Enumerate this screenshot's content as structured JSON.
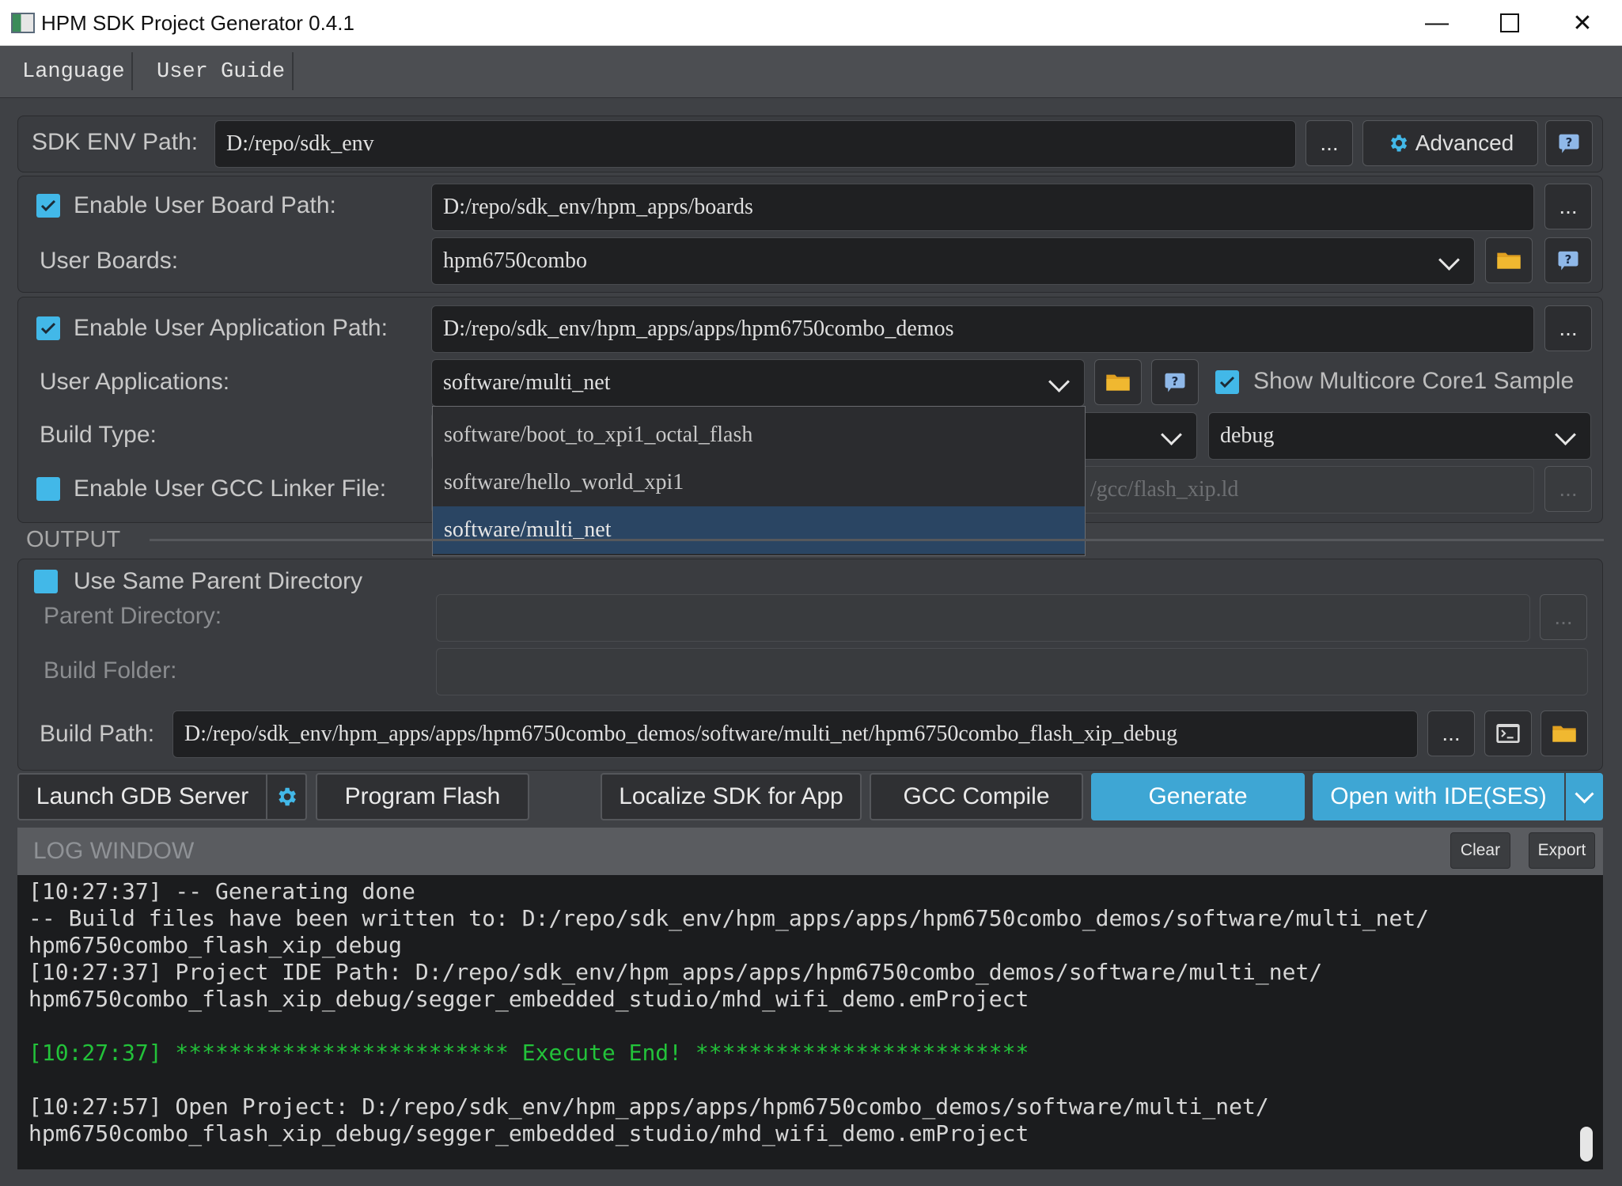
{
  "window": {
    "title": "HPM SDK Project Generator 0.4.1"
  },
  "menu": {
    "language": "Language",
    "user_guide": "User Guide"
  },
  "sdk_env": {
    "label": "SDK ENV Path:",
    "value": "D:/repo/sdk_env",
    "browse": "...",
    "advanced": "Advanced"
  },
  "board": {
    "enable_label": "Enable User Board Path:",
    "path": "D:/repo/sdk_env/hpm_apps/boards",
    "browse": "...",
    "boards_label": "User Boards:",
    "boards_value": "hpm6750combo"
  },
  "app": {
    "enable_label": "Enable User Application Path:",
    "path": "D:/repo/sdk_env/hpm_apps/apps/hpm6750combo_demos",
    "browse": "...",
    "apps_label": "User Applications:",
    "apps_value": "software/multi_net",
    "show_multicore": "Show Multicore Core1 Sample",
    "build_type_label": "Build Type:",
    "build_type_value": "debug",
    "gcc_label": "Enable User GCC Linker File:",
    "gcc_value": "/gcc/flash_xip.ld",
    "gcc_browse": "...",
    "dropdown_options": [
      "software/boot_to_xpi1_octal_flash",
      "software/hello_world_xpi1",
      "software/multi_net"
    ]
  },
  "output": {
    "section": "OUTPUT",
    "same_parent": "Use Same Parent Directory",
    "parent_label": "Parent Directory:",
    "parent_browse": "...",
    "build_folder_label": "Build Folder:",
    "build_path_label": "Build Path:",
    "build_path_value": "D:/repo/sdk_env/hpm_apps/apps/hpm6750combo_demos/software/multi_net/hpm6750combo_flash_xip_debug",
    "build_browse": "..."
  },
  "actions": {
    "launch_gdb": "Launch GDB Server",
    "program_flash": "Program Flash",
    "localize_sdk": "Localize SDK for App",
    "gcc_compile": "GCC Compile",
    "generate": "Generate",
    "open_ide": "Open with IDE(SES)"
  },
  "log": {
    "title": "LOG WINDOW",
    "clear": "Clear",
    "export": "Export",
    "lines": [
      "[10:27:37] -- Generating done",
      "-- Build files have been written to: D:/repo/sdk_env/hpm_apps/apps/hpm6750combo_demos/software/multi_net/",
      "hpm6750combo_flash_xip_debug",
      "[10:27:37] Project IDE Path: D:/repo/sdk_env/hpm_apps/apps/hpm6750combo_demos/software/multi_net/",
      "hpm6750combo_flash_xip_debug/segger_embedded_studio/mhd_wifi_demo.emProject",
      "",
      "[10:27:37] ************************* Execute End! *************************",
      "",
      "[10:27:57] Open Project: D:/repo/sdk_env/hpm_apps/apps/hpm6750combo_demos/software/multi_net/",
      "hpm6750combo_flash_xip_debug/segger_embedded_studio/mhd_wifi_demo.emProject"
    ]
  },
  "colors": {
    "accent": "#3ea6d4",
    "checkbox": "#42b8e8",
    "folder": "#e0a020",
    "log_green": "#23c23a"
  }
}
